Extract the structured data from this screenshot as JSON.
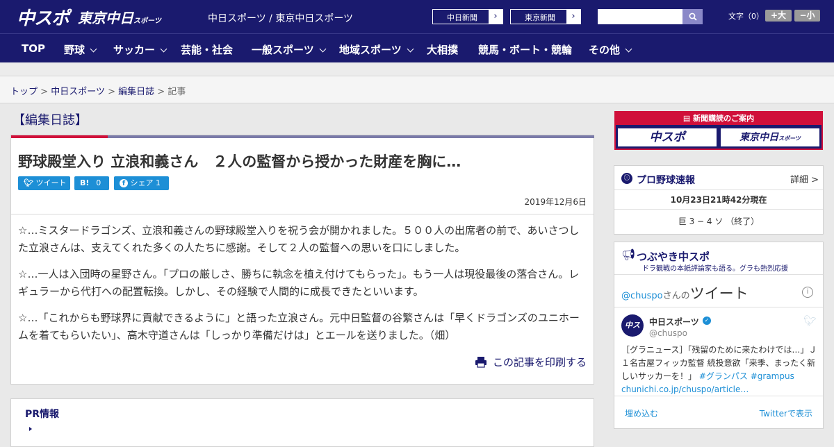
{
  "header": {
    "logo_main": "中スポ",
    "logo_tokyo": "東京中日",
    "logo_tokyo_small": "スポーツ",
    "site_names": "中日スポーツ / 東京中日スポーツ",
    "link_chunichi": "中日新聞",
    "link_tokyo": "東京新聞",
    "search_placeholder": "",
    "font_label": "文字（0）",
    "font_bigger": "+大",
    "font_smaller": "−小"
  },
  "nav": {
    "items": [
      {
        "label": "TOP"
      },
      {
        "label": "野球"
      },
      {
        "label": "サッカー"
      },
      {
        "label": "芸能・社会"
      },
      {
        "label": "一般スポーツ"
      },
      {
        "label": "地域スポーツ"
      },
      {
        "label": "大相撲"
      },
      {
        "label": "競馬・ボート・競輪"
      },
      {
        "label": "その他"
      }
    ]
  },
  "breadcrumb": {
    "top": "トップ",
    "chunichi": "中日スポーツ",
    "category": "編集日誌",
    "current": "記事",
    "sep": ">"
  },
  "category_title": "【編集日誌】",
  "article": {
    "title": "野球殿堂入り 立浪和義さん　２人の監督から授かった財産を胸に…",
    "share_tweet": "ツイート",
    "share_hatena_count": "0",
    "share_fb": "シェア",
    "share_fb_count": "1",
    "date": "2019年12月6日",
    "paragraphs": [
      "☆…ミスタードラゴンズ、立浪和義さんの野球殿堂入りを祝う会が開かれました。５００人の出席者の前で、あいさつした立浪さんは、支えてくれた多くの人たちに感謝。そして２人の監督への思いを口にしました。",
      "☆…一人は入団時の星野さん。「プロの厳しさ、勝ちに執念を植え付けてもらった」。もう一人は現役最後の落合さん。レギュラーから代打への配置転換。しかし、その経験で人間的に成長できたといいます。",
      "☆…「これからも野球界に貢献できるように」と語った立浪さん。元中日監督の谷繁さんは「早くドラゴンズのユニホームを着てもらいたい」、高木守道さんは「しっかり準備だけは」とエールを送りました。（畑）"
    ],
    "print_label": "この記事を印刷する"
  },
  "pr": {
    "title": "PR情報"
  },
  "sidebar": {
    "subscribe": {
      "header": "新聞購読のご案内",
      "logo1": "中スポ",
      "logo2": "東京中日",
      "logo2_small": "スポーツ"
    },
    "baseball": {
      "title": "プロ野球速報",
      "detail": "詳細 >",
      "updated": "10月23日21時42分現在",
      "score": "巨 3 − 4 ソ （終了）"
    },
    "twitter": {
      "title": "つぶやき中スポ",
      "subtitle": "ドラ観戦の本紙評論家も語る。グラも熱烈応援",
      "handle_prefix": "@chuspo",
      "handle_suffix": "さんの",
      "tweet_word": "ツイート",
      "account_name": "中日スポーツ",
      "account_handle": "@chuspo",
      "tweet_text": "［グラニュース］「残留のために来たわけでは…」Ｊ１名古屋フィッカ監督 続投意欲「来季、まったく新しいサッカーを！」",
      "hashtags": "#グランパス #grampus",
      "link": "chunichi.co.jp/chuspo/article…",
      "embed": "埋め込む",
      "view_on_twitter": "Twitterで表示"
    }
  },
  "colors": {
    "navy": "#1a1a6e",
    "red": "#d0103a",
    "twitter": "#1d8fd6"
  }
}
